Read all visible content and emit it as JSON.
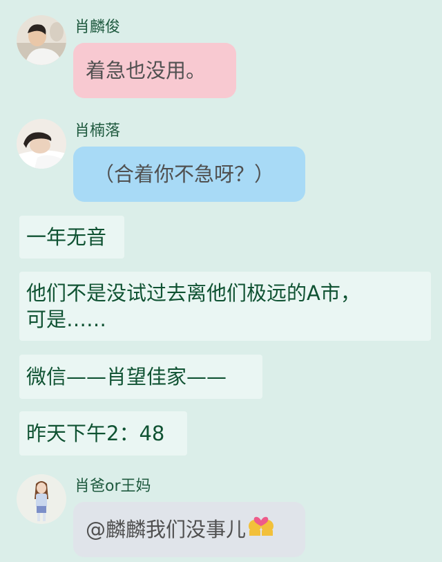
{
  "messages": [
    {
      "sender": "肖麟俊",
      "text": "着急也没用。",
      "avatar_icon": "man-resting-avatar",
      "bubble_color": "#f8c9d1"
    },
    {
      "sender": "肖楠落",
      "text": "（合着你不急呀？）",
      "avatar_icon": "man-lying-down-avatar",
      "bubble_color": "#a8daf6"
    },
    {
      "sender": "肖爸or王妈",
      "text": "@麟麟我们没事儿",
      "avatar_icon": "girl-illustration-avatar",
      "bubble_color": "#e0e4ea",
      "emoji": "couple-with-heart-emoji"
    }
  ],
  "narration": [
    "一年无音",
    "他们不是没试过去离他们极远的A市，",
    "可是……",
    "微信——肖望佳家——",
    "昨天下午2：48"
  ],
  "colors": {
    "background": "#dbeee9",
    "narration_bg": "#eaf6f3",
    "narration_text": "#0f5232",
    "name_text": "#1f5a3f"
  }
}
